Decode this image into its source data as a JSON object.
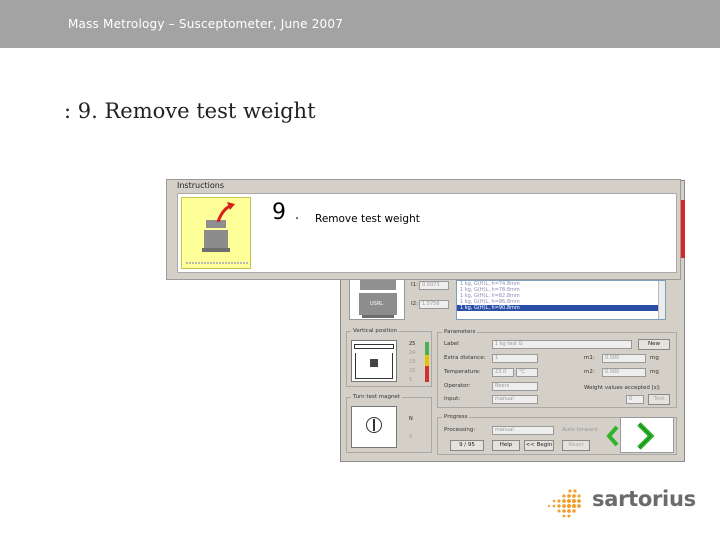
{
  "header": {
    "title": "Mass Metrology – Susceptometer, June 2007"
  },
  "heading": ": 9. Remove test weight",
  "instructions": {
    "group_label": "Instructions",
    "step_number": "9",
    "step_separator": ".",
    "step_text": "Remove test weight"
  },
  "app": {
    "readouts": [
      {
        "label": "I1:",
        "value": "0.5073"
      },
      {
        "label": "I2:",
        "value": "1.5756"
      }
    ],
    "weight_icon_label": "USRL",
    "list_items": [
      "1 kg, G(H)L, h=74.8mm",
      "1 kg, G(H)L, h=78.8mm",
      "1 kg, G(H)L, h=82.8mm",
      "1 kg, G(H)L, h=86.8mm",
      "1 kg, G(H)L, h=90.8mm"
    ],
    "selected_list_index": 4,
    "vertical_position": {
      "label": "Vertical position",
      "options": [
        "25",
        "24",
        "23",
        "22",
        "5"
      ],
      "selected_index": 0
    },
    "turn_magnet": {
      "label": "Turn test magnet",
      "options": [
        "N",
        "S"
      ],
      "selected_index": 0
    },
    "parameters": {
      "label": "Parameters",
      "label_field_label": "Label",
      "label_field_value": "1 kg test G",
      "new_button": "New",
      "distance_label": "Extra distance:",
      "distance_value": "1",
      "temperature_label": "Temperature:",
      "temperature_value": "23.0",
      "temperature_unit": "°C",
      "operator_label": "Operator:",
      "operator_value": "Beers",
      "input_label": "Input:",
      "input_value": "manual",
      "m1_label": "m1:",
      "m1_value": "0.000",
      "m1_unit": "mg",
      "m2_label": "m2:",
      "m2_value": "0.000",
      "m2_unit": "mg",
      "accept_label": "Weight values accepted [s]:",
      "accept_value": "0",
      "test_button": "Test"
    },
    "progress": {
      "label": "Progress",
      "processing_label": "Processing:",
      "processing_value": "manual",
      "auto_forward_label": "Auto forward",
      "counter": "9 / 95",
      "help_button": "Help",
      "begin_button": "<< Begin",
      "reset_button": "Reset"
    }
  },
  "logo": {
    "text": "sartorius",
    "color": "#6b6b6b",
    "accent": "#f0a030"
  },
  "colors": {
    "topbar": "#a3a3a3",
    "arrow_green": "#2fb32f",
    "step_icon_bg": "#ffff99",
    "arrow_red": "#d6201b"
  }
}
